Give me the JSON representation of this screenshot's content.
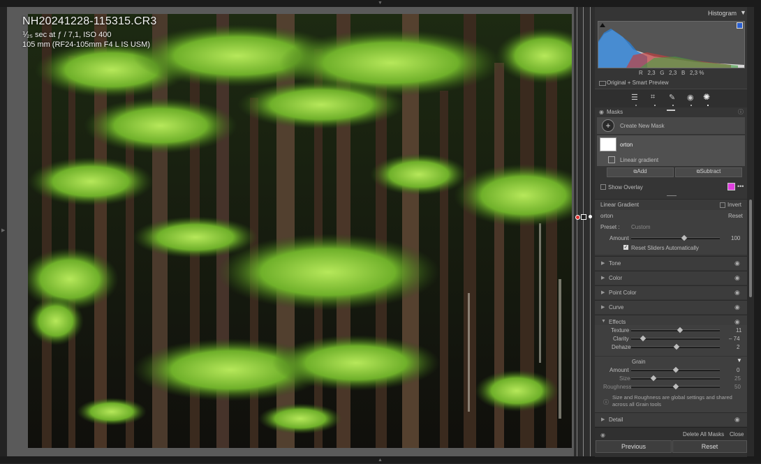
{
  "photo_info": {
    "filename": "NH20241228-115315.CR3",
    "exposure": "⅟₂₅ sec at ƒ / 7,1, ISO 400",
    "lens": "105 mm (RF24-105mm F4 L IS USM)"
  },
  "histogram": {
    "title": "Histogram",
    "readout": {
      "r_label": "R",
      "r_value": "2,3",
      "g_label": "G",
      "g_value": "2,3",
      "b_label": "B",
      "b_value": "2,3",
      "unit": "%"
    },
    "preview_label": "Original + Smart Preview"
  },
  "tools": {
    "icons": [
      "sliders-icon",
      "crop-icon",
      "heal-icon",
      "redeye-icon",
      "masking-icon"
    ]
  },
  "masks": {
    "title": "Masks",
    "create_label": "Create New Mask",
    "mask_name": "orton",
    "component_name": "Lineair gradient",
    "add_label": "Add",
    "subtract_label": "Subtract",
    "show_overlay_label": "Show Overlay",
    "overlay_color": "#e040e0"
  },
  "gradient": {
    "title": "Linear Gradient",
    "invert_label": "Invert",
    "name": "orton",
    "reset_label": "Reset",
    "preset_label": "Preset :",
    "preset_value": "Custom",
    "amount_label": "Amount",
    "amount_value": "100",
    "amount_level": 0.6,
    "reset_sliders_label": "Reset Sliders Automatically"
  },
  "sections": {
    "tone": "Tone",
    "color": "Color",
    "point_color": "Point Color",
    "curve": "Curve",
    "effects": "Effects",
    "detail": "Detail"
  },
  "effects": {
    "texture_label": "Texture",
    "texture_value": "11",
    "texture_level": 0.55,
    "clarity_label": "Clarity",
    "clarity_value": "– 74",
    "clarity_level": 0.13,
    "dehaze_label": "Dehaze",
    "dehaze_value": "2",
    "dehaze_level": 0.51
  },
  "grain": {
    "title": "Grain",
    "amount_label": "Amount",
    "amount_value": "0",
    "amount_level": 0.5,
    "size_label": "Size",
    "size_value": "25",
    "size_level": 0.25,
    "roughness_label": "Roughness",
    "roughness_value": "50",
    "roughness_level": 0.5,
    "note": "Size and Roughness are global settings and shared across all Grain tools"
  },
  "footer": {
    "delete_all_label": "Delete All Masks",
    "close_label": "Close",
    "previous_label": "Previous",
    "reset_label": "Reset"
  },
  "colors": {
    "overlay": "#e040e0",
    "accent_blue": "#2a5fd0"
  }
}
